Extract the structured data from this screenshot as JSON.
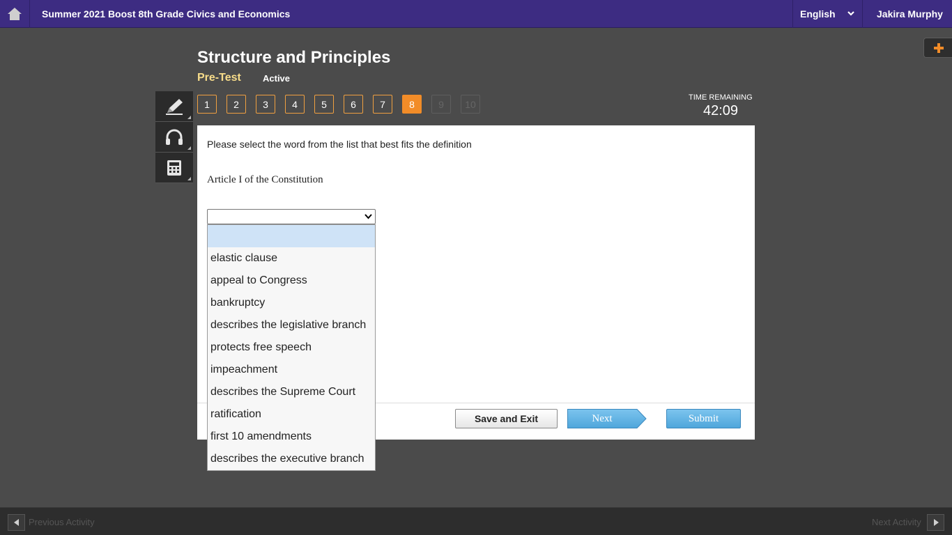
{
  "header": {
    "course_title": "Summer 2021 Boost 8th Grade Civics and Economics",
    "language": "English",
    "user_name": "Jakira Murphy"
  },
  "activity": {
    "title": "Structure and Principles",
    "type": "Pre-Test",
    "status": "Active"
  },
  "question_nav": {
    "items": [
      "1",
      "2",
      "3",
      "4",
      "5",
      "6",
      "7",
      "8",
      "9",
      "10"
    ],
    "current": "8"
  },
  "timer": {
    "label": "TIME REMAINING",
    "value": "42:09"
  },
  "question": {
    "prompt": "Please select the word from the list that best fits the definition",
    "definition": "Article I of the Constitution",
    "selected_value": ""
  },
  "dropdown": {
    "options": [
      "",
      "elastic clause",
      "appeal to Congress",
      "bankruptcy",
      "describes the legislative branch",
      "protects free speech",
      "impeachment",
      "describes the Supreme Court",
      "ratification",
      "first 10 amendments",
      "describes the executive branch"
    ]
  },
  "buttons": {
    "save_exit": "Save and Exit",
    "next": "Next",
    "submit": "Submit"
  },
  "footer": {
    "previous": "Previous Activity",
    "next": "Next Activity"
  },
  "colors": {
    "topbar": "#3d2c82",
    "accent_orange": "#f28c28",
    "pretest_label": "#f7dc8a",
    "primary_button": "#5aaee0"
  },
  "icons": {
    "home": "home-icon",
    "plus": "plus-icon",
    "pencil": "pencil-icon",
    "headphones": "headphones-icon",
    "calculator": "calculator-icon"
  }
}
